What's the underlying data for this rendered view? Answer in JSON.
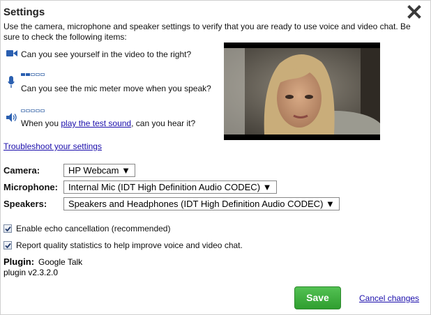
{
  "dialog": {
    "title": "Settings",
    "intro": "Use the camera, microphone and speaker settings to verify that you are ready to use voice and video chat. Be sure to check the following items:"
  },
  "checks": {
    "camera_question": "Can you see yourself in the video to the right?",
    "mic_question": "Can you see the mic meter move when you speak?",
    "sound_prefix": "When you ",
    "sound_link": "play the test sound",
    "sound_suffix": ", can you hear it?"
  },
  "troubleshoot_link": "Troubleshoot your settings",
  "devices": {
    "camera_label": "Camera:",
    "camera_value": "HP Webcam ▼",
    "microphone_label": "Microphone:",
    "microphone_value": "Internal Mic (IDT High Definition Audio CODEC) ▼",
    "speakers_label": "Speakers:",
    "speakers_value": "Speakers and Headphones (IDT High Definition Audio CODEC) ▼"
  },
  "options": {
    "echo_label": "Enable echo cancellation (recommended)",
    "echo_checked": true,
    "stats_label": "Report quality statistics to help improve voice and video chat.",
    "stats_checked": true
  },
  "plugin": {
    "label": "Plugin:",
    "name": "Google Talk",
    "version": "plugin v2.3.2.0"
  },
  "actions": {
    "save_label": "Save",
    "cancel_label": "Cancel changes"
  },
  "icons": {
    "close": "close-icon",
    "camera": "video-camera-icon",
    "microphone": "microphone-icon",
    "speaker": "speaker-icon"
  },
  "colors": {
    "save_button": "#3aa93a",
    "link": "#1a0dab",
    "icon_blue": "#2a5fb0"
  }
}
